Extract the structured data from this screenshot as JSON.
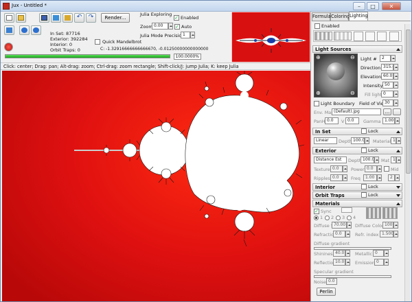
{
  "window": {
    "title": "Jux - Untitled *",
    "minimize": "–",
    "maximize": "□",
    "close": "✕"
  },
  "toolbar": {
    "render_label": "Render..."
  },
  "julia": {
    "title": "Julia Exploring",
    "enabled_label": "Enabled",
    "enabled": true,
    "zoom_label": "Zoom",
    "zoom_value": "0.00",
    "auto_label": "Auto",
    "auto": true,
    "precision_label": "Julia Mode Precision",
    "precision_value": "1"
  },
  "stats": {
    "in_set": "In Set: 87716",
    "exterior": "Exterior: 392284",
    "interior": "Interior: 0",
    "orbit_traps": "Orbit Traps: 0"
  },
  "quick_mandelbrot_label": "Quick Mandelbrot",
  "coords_text": "C: -1.32916666666666670, -0.01250000000000000",
  "progress": {
    "percent": 100,
    "label": "100.0000%"
  },
  "status_text": "Click: center; Drag: pan; Alt-drag: zoom; Ctrl-drag: zoom rectangle; Shift-click/J: jump Julia; K: keep Julia",
  "tabs": [
    "Formula",
    "Coloring",
    "Lighting"
  ],
  "lighting": {
    "enabled_label": "Enabled",
    "sources_title": "Light Sources",
    "light_label": "Light #",
    "light_value": "2",
    "direction_label": "Direction",
    "direction_value": "315.0",
    "elevation_label": "Elevation",
    "elevation_value": "60.0",
    "intensity_label": "Intensity",
    "intensity_value": "50",
    "fill_label": "Fill light",
    "fill_value": "0",
    "boundary_label": "Light Boundary",
    "fov_label": "Field of View",
    "fov_value": "30",
    "env_label": "Env. Map",
    "env_value": "(Default).jpg",
    "env_btn": "...",
    "panh_label": "PanH",
    "panh_value": "0.0",
    "v_label": "V",
    "v_value": "0.0",
    "gamma_label": "Gamma",
    "gamma_value": "1.00"
  },
  "in_set": {
    "title": "In Set",
    "lock_label": "Lock",
    "mode": "Linear",
    "depth_label": "Depth",
    "depth_value": "100.0",
    "material_label": "Material",
    "material_value": "1"
  },
  "exterior": {
    "title": "Exterior",
    "lock_label": "Lock",
    "mode": "Distance Est",
    "depth_label": "Depth",
    "depth_value": "100.0",
    "mat_label": "Mat",
    "mat_value": "1",
    "texture_label": "Texture",
    "texture_value": "0.0",
    "power_label": "Power",
    "power_value": "0.0",
    "mid_label": "Mid",
    "ripples_label": "Ripples",
    "ripples_value": "0.0",
    "freq_label": "Freq",
    "freq_value": "1.00",
    "freq2_value": "2"
  },
  "interior": {
    "title": "Interior",
    "lock_label": "Lock"
  },
  "orbit_traps": {
    "title": "Orbit Traps",
    "lock_label": "Lock"
  },
  "materials": {
    "title": "Materials",
    "sync_label": "Sync",
    "radios": [
      "1",
      "2",
      "3",
      "4"
    ],
    "diffuse_s_label": "Diffuse S.",
    "diffuse_s_value": "70.00",
    "diffuse_color_label": "Diffuse Color",
    "diffuse_color_value": "100",
    "refraction_label": "Refraction",
    "refraction_value": "0.0",
    "ref_index_label": "Refr. index",
    "ref_index_value": "1.500",
    "diffuse_gradient_label": "Diffuse gradient",
    "shininess_label": "Shininess",
    "shininess_value": "40.0",
    "metallic_label": "Metallic",
    "metallic_value": "0",
    "reflection_label": "Reflection",
    "reflection_value": "10.0",
    "emission_label": "Emission",
    "emission_value": "0",
    "specular_gradient_label": "Specular gradient",
    "noise_label": "Noise",
    "noise_value": "0.0",
    "perlin_label": "Perlin"
  },
  "colors": {
    "fractal_bg": "#e01010",
    "set": "#ffffff",
    "accent": "#1a3ea8"
  }
}
